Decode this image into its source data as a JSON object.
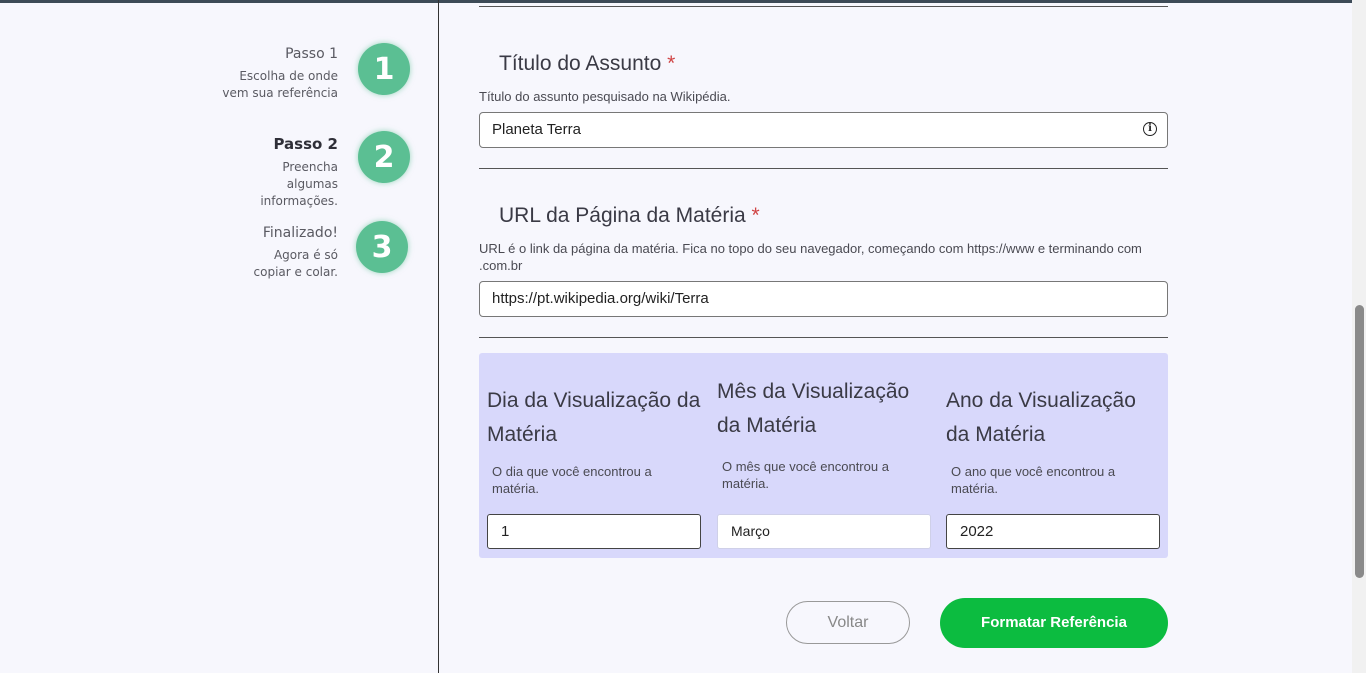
{
  "steps": [
    {
      "title": "Passo 1",
      "desc": "Escolha de onde vem sua referência",
      "number": "1",
      "active": false
    },
    {
      "title": "Passo 2",
      "desc": "Preencha algumas informações.",
      "number": "2",
      "active": true
    },
    {
      "title": "Finalizado!",
      "desc": "Agora é só copiar e colar.",
      "number": "3",
      "active": false
    }
  ],
  "form": {
    "subject": {
      "title": "Título do Assunto",
      "required_mark": "*",
      "desc": "Título do assunto pesquisado na Wikipédia.",
      "value": "Planeta Terra",
      "info_icon": "info-icon"
    },
    "url": {
      "title": "URL da Página da Matéria",
      "required_mark": "*",
      "desc": "URL é o link da página da matéria. Fica no topo do seu navegador, começando com https://www e terminando com .com.br",
      "value": "https://pt.wikipedia.org/wiki/Terra"
    },
    "date": {
      "day": {
        "title": "Dia da Visualização da Matéria",
        "desc": "O dia que você encontrou a matéria.",
        "value": "1"
      },
      "month": {
        "title": "Mês da Visualização da Matéria",
        "desc": "O mês que você encontrou a matéria.",
        "value": "Março"
      },
      "year": {
        "title": "Ano da Visualização da Matéria",
        "desc": "O ano que você encontrou a matéria.",
        "value": "2022"
      }
    }
  },
  "buttons": {
    "back": "Voltar",
    "submit": "Formatar Referência"
  },
  "colors": {
    "accent_green": "#0cbc40",
    "step_green": "#5bbf93",
    "date_panel": "#d8d8fb",
    "required": "#d04545"
  }
}
